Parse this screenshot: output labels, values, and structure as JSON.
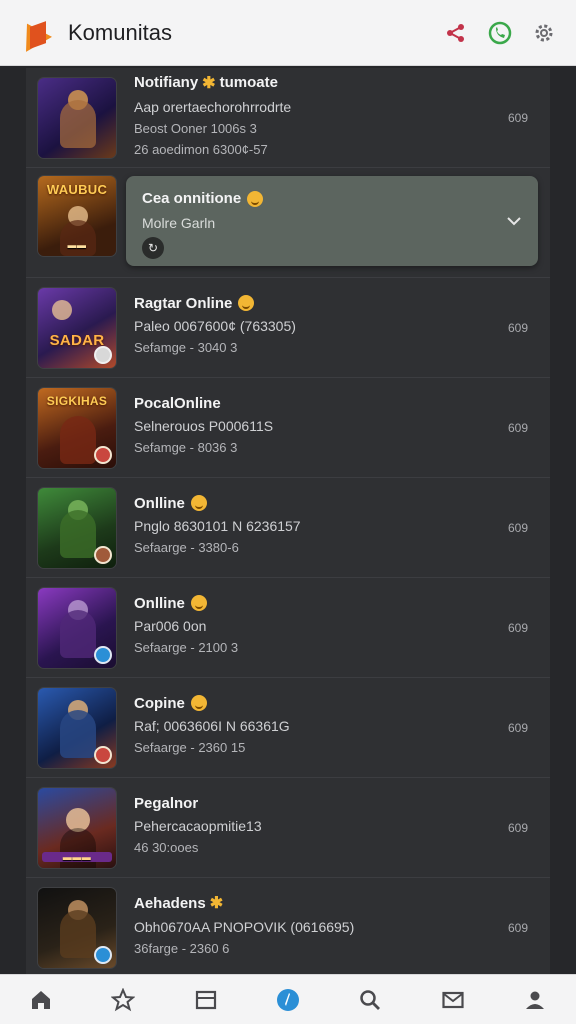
{
  "header": {
    "title": "Komunitas",
    "icons": [
      "share-icon",
      "phone-icon",
      "settings-icon"
    ]
  },
  "colors": {
    "accent": "#2b8fd6",
    "share": "#c2334a",
    "phone": "#3aa84a"
  },
  "items": [
    {
      "thumb_text": "",
      "name": "Notifiany",
      "name2": "tumoate",
      "has_star": true,
      "line1": "Aap orertaechorohrrodrte",
      "line2": "Beost Ooner 1006s 3",
      "line3": "26 aoedimon 6300¢-57",
      "meta": "609"
    },
    {
      "thumb_text": "WAUBUC",
      "name": "Cea onnitione",
      "line1": "Molre Garln",
      "meta": ""
    },
    {
      "thumb_text": "SADAR",
      "name": "Ragtar Online",
      "line1": "Paleo 0067600¢ (763305)",
      "line2": "Sefamge - 3040 3",
      "meta": "609"
    },
    {
      "thumb_text": "SIGKIHAS",
      "name": "PocalOnline",
      "line1": "Selnerouos P000611S",
      "line2": "Sefamge - 8036 3",
      "meta": "609"
    },
    {
      "thumb_text": "",
      "name": "Onlline",
      "line1": "Pnglo 8630101 N 6236157",
      "line2": "Sefaarge - 3380-6",
      "meta": "609"
    },
    {
      "thumb_text": "",
      "name": "Onlline",
      "line1": "Par006 0on",
      "line2": "Sefaarge - 2100 3",
      "meta": "609"
    },
    {
      "thumb_text": "",
      "name": "Copine",
      "line1": "Raf; 0063606I N 66361G",
      "line2": "Sefaarge - 2360 15",
      "meta": "609"
    },
    {
      "thumb_text": "",
      "name": "Pegalnor",
      "line1": "Pehercacaopmitie13",
      "line2": "46 30:ooes",
      "meta": "609"
    },
    {
      "thumb_text": "",
      "name": "Aehadens",
      "line1": "Obh0670AA PNOPOVIK (0616695)",
      "line2": "36farge - 2360 6",
      "meta": "609"
    }
  ],
  "nav": [
    "home-icon",
    "star-icon",
    "news-icon",
    "compass-icon",
    "search-icon",
    "mail-icon",
    "profile-icon"
  ]
}
